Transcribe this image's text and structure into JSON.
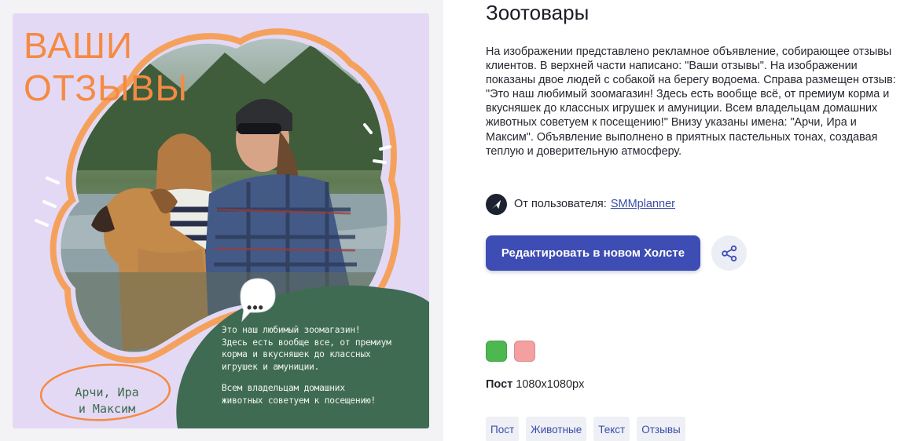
{
  "poster": {
    "title": "ВАШИ\nОТЗЫВЫ",
    "review_1": "Это наш любимый зоомагазин!\nЗдесь есть вообще все, от премиум\nкорма и вкусняшек до классных\nигрушек и амуниции.",
    "review_2": "Всем владельцам домашних\nживотных советуем к посещению!",
    "names": "Арчи, Ира\nи Максим",
    "bubble": "•••",
    "colors": {
      "background": "#e3d9f4",
      "accent_orange": "#f58a43",
      "blob_green": "#3f6b52"
    }
  },
  "details": {
    "title": "Зоотовары",
    "description": "На изображении представлено рекламное объявление, собирающее отзывы клиентов. В верхней части написано: \"Ваши отзывы\". На изображении показаны двое людей с собакой на берегу водоема. Справа размещен отзыв: \"Это наш любимый зоомагазин! Здесь есть вообще всё, от премиум корма и вкусняшек до классных игрушек и амуниции. Всем владельцам домашних животных советуем к посещению!\" Внизу указаны имена: \"Арчи, Ира и Максим\". Объявление выполнено в приятных пастельных тонах, создавая теплую и доверительную атмосферу.",
    "author_prefix": "От пользователя:",
    "author_name": "SMMplanner",
    "author_icon": "send-arrow-icon",
    "edit_label": "Редактировать в новом Холсте",
    "share_icon": "share-icon",
    "swatches": [
      "#4cb84f",
      "#f5a0a0"
    ],
    "size_label": "Пост",
    "size_value": "1080x1080px",
    "tags": [
      "Пост",
      "Животные",
      "Текст",
      "Отзывы"
    ],
    "accent_color": "#3e4db3"
  }
}
